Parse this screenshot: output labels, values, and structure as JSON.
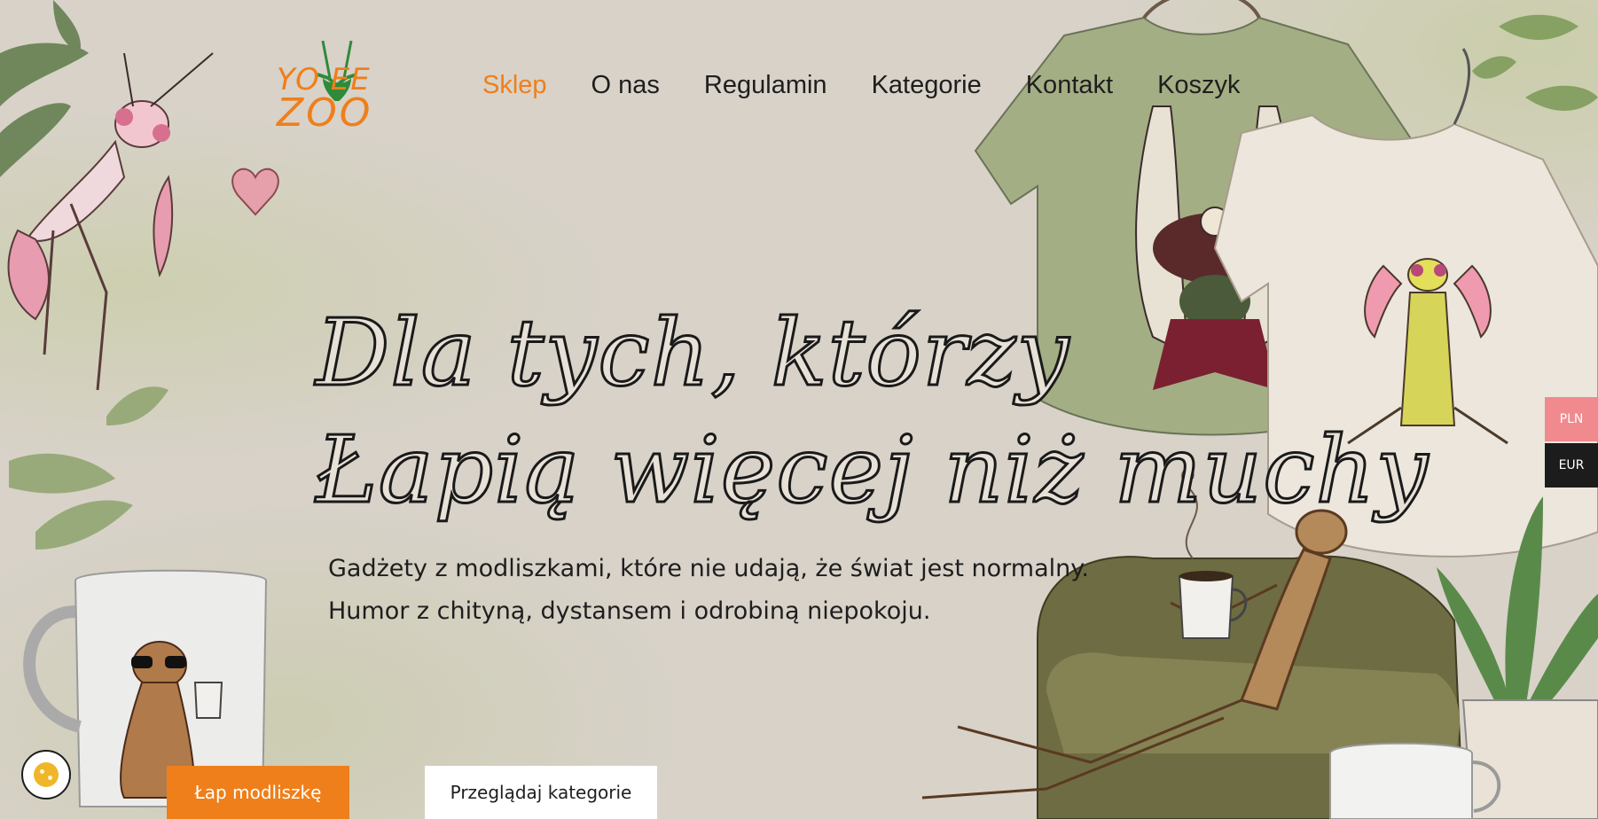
{
  "brand": {
    "logo_line1": "YO EE",
    "logo_line2": "ZOO",
    "accent": "#ef7f1a"
  },
  "nav": {
    "items": [
      {
        "label": "Sklep",
        "active": true
      },
      {
        "label": "O nas"
      },
      {
        "label": "Regulamin"
      },
      {
        "label": "Kategorie"
      },
      {
        "label": "Kontakt"
      },
      {
        "label": "Koszyk"
      }
    ]
  },
  "hero": {
    "title_line1": "Dla tych, którzy",
    "title_line2": "Łapią więcej niż muchy",
    "subtitle_line1": "Gadżety z modliszkami, które nie udają, że świat jest normalny.",
    "subtitle_line2": "Humor z chityną, dystansem i odrobiną niepokoju."
  },
  "buttons": {
    "primary": "Łap modliszkę",
    "secondary": "Przeglądaj kategorie"
  },
  "currency": {
    "options": [
      "PLN",
      "EUR"
    ],
    "selected": "PLN",
    "pln_color": "#f08a8e",
    "eur_color": "#1c1c1c"
  },
  "icons": {
    "cookie": "cookie-icon"
  }
}
